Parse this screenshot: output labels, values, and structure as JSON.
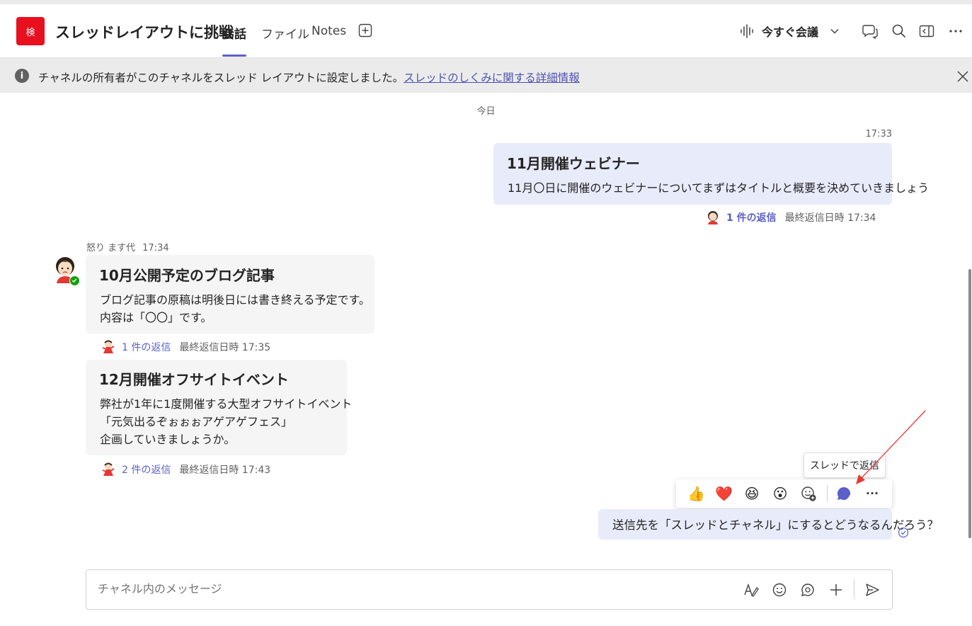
{
  "colors": {
    "brand": "#5b5fc7",
    "team_avatar": "#e8101f",
    "own_bubble": "#e8ebfa",
    "other_bubble": "#f5f5f5",
    "banner_bg": "#ebebeb",
    "annotation_arrow": "#e53935"
  },
  "header": {
    "team_avatar_text": "検",
    "channel_title": "スレッドレイアウトに挑戦",
    "tabs": [
      {
        "label": "会話",
        "active": true
      },
      {
        "label": "ファイル",
        "active": false
      },
      {
        "label": "Notes",
        "active": false
      }
    ],
    "add_tab_icon": "plus-square-icon",
    "meet_now_label": "今すぐ会議",
    "icons": [
      "waveform-icon",
      "chevron-down-icon",
      "chat-bubbles-icon",
      "search-icon",
      "popout-icon",
      "more-icon"
    ]
  },
  "banner": {
    "info_glyph": "i",
    "text": "チャネルの所有者がこのチャネルをスレッド レイアウトに設定しました。",
    "link": "スレッドのしくみに関する詳細情報"
  },
  "chat": {
    "date_divider": "今日",
    "own_post_1": {
      "time": "17:33",
      "subject": "11月開催ウェビナー",
      "body": "11月〇日に開催のウェビナーについてまずはタイトルと概要を決めていきましょう",
      "reply_count": "1 件の返信",
      "last_reply": "最終返信日時 17:34"
    },
    "sender": {
      "name": "怒り ます代",
      "time": "17:34"
    },
    "post_2": {
      "subject": "10月公開予定のブログ記事",
      "body_lines": [
        "ブログ記事の原稿は明後日には書き終える予定です。",
        "内容は「〇〇」です。"
      ],
      "reply_count": "1 件の返信",
      "last_reply": "最終返信日時 17:35"
    },
    "post_3": {
      "subject": "12月開催オフサイトイベント",
      "body_lines": [
        "弊社が1年に1度開催する大型オフサイトイベント",
        "「元気出るぞぉぉぉアゲアゲフェス」",
        "企画していきましょうか。"
      ],
      "reply_count": "2 件の返信",
      "last_reply": "最終返信日時 17:43"
    },
    "tooltip": "スレッドで返信",
    "reactions": [
      "👍",
      "❤️",
      "😆",
      "😮"
    ],
    "reaction_icons": [
      "thumbs-up-icon",
      "heart-icon",
      "laugh-icon",
      "surprised-icon",
      "add-reaction-icon",
      "reply-in-thread-icon",
      "more-options-icon"
    ],
    "more_glyph": "···",
    "final_message": "送信先を「スレッドとチャネル」にするとどうなるんだろう？"
  },
  "compose": {
    "placeholder": "チャネル内のメッセージ",
    "icons": [
      "format-icon",
      "emoji-icon",
      "loop-icon",
      "attach-plus-icon",
      "send-icon"
    ]
  }
}
